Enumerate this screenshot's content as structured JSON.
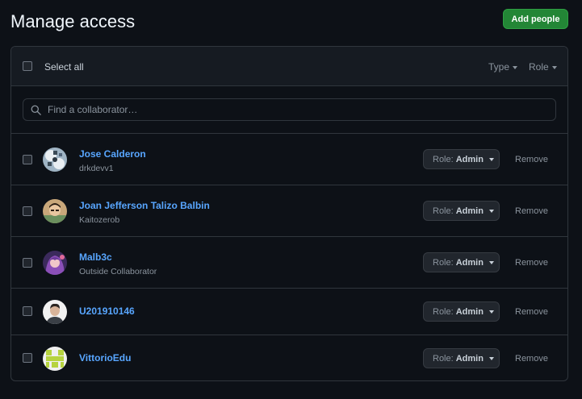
{
  "page": {
    "title": "Manage access",
    "add_button": "Add people"
  },
  "header": {
    "select_all": "Select all",
    "filters": [
      {
        "label": "Type"
      },
      {
        "label": "Role"
      }
    ]
  },
  "search": {
    "placeholder": "Find a collaborator…",
    "value": ""
  },
  "role_prefix": "Role:",
  "remove_label": "Remove",
  "members": [
    {
      "name": "Jose Calderon",
      "subtitle": "drkdevv1",
      "role": "Admin",
      "avatar": "geometric-pattern-avatar"
    },
    {
      "name": "Joan Jefferson Talizo Balbin",
      "subtitle": "Kaitozerob",
      "role": "Admin",
      "avatar": "cartoon-avatar"
    },
    {
      "name": "Malb3c",
      "subtitle": "Outside Collaborator",
      "role": "Admin",
      "avatar": "anime-avatar"
    },
    {
      "name": "U201910146",
      "subtitle": "",
      "role": "Admin",
      "avatar": "photo-avatar"
    },
    {
      "name": "VittorioEdu",
      "subtitle": "",
      "role": "Admin",
      "avatar": "identicon-avatar"
    }
  ],
  "colors": {
    "background": "#0d1117",
    "panel_header": "#161b22",
    "border": "#30363d",
    "link": "#58a6ff",
    "primary_button": "#238636",
    "identicon": "#b6d33f"
  }
}
